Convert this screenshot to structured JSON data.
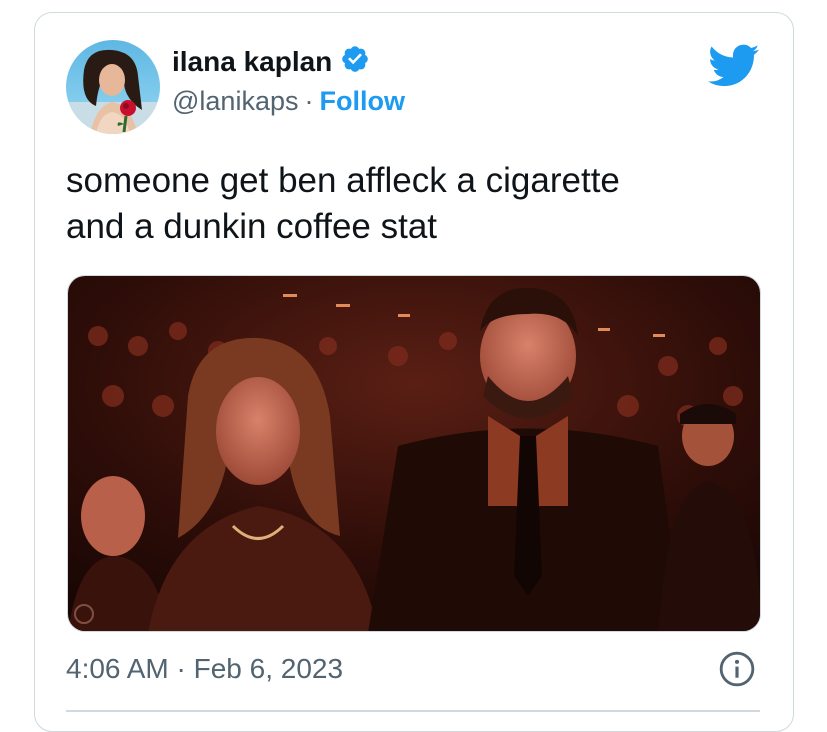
{
  "tweet": {
    "author": {
      "display_name": "ilana kaplan",
      "handle": "@lanikaps",
      "separator": "·",
      "follow_label": "Follow",
      "verified": true
    },
    "text_lines": [
      "someone get ben affleck a cigarette",
      "and a dunkin coffee stat"
    ],
    "timestamp": "4:06 AM · Feb 6, 2023",
    "icons": {
      "brand": "twitter-bird-icon",
      "verified": "verified-badge-icon",
      "info": "info-icon"
    },
    "colors": {
      "accent": "#1d9bf0",
      "text": "#0f1419",
      "secondary": "#536471",
      "border": "#cfd9de"
    }
  }
}
